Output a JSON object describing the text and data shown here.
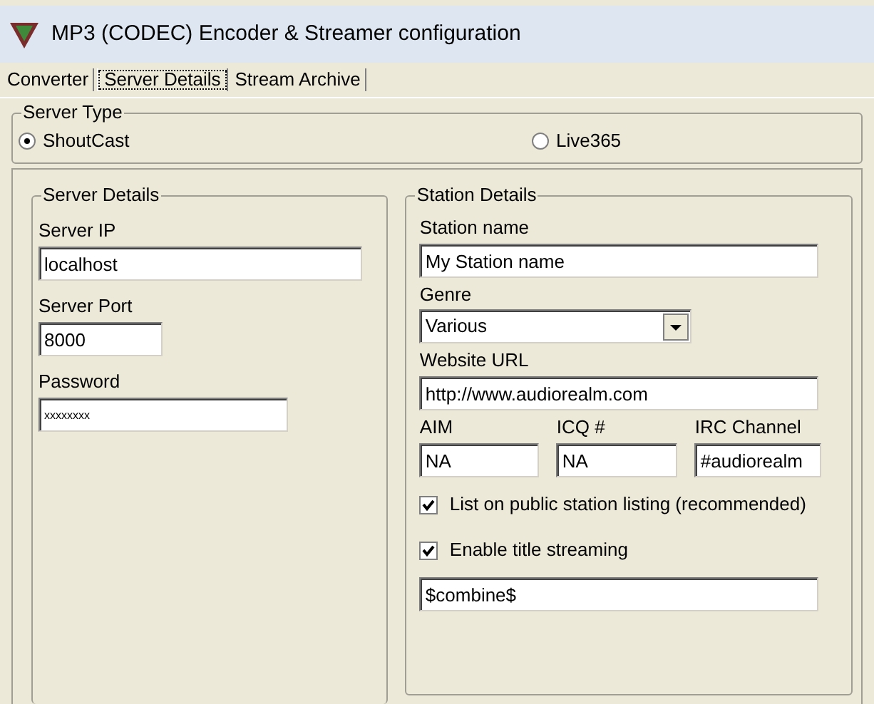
{
  "window": {
    "title": "MP3 (CODEC) Encoder & Streamer configuration"
  },
  "tabs": [
    {
      "label": "Converter",
      "selected": false
    },
    {
      "label": "Server Details",
      "selected": true
    },
    {
      "label": "Stream Archive",
      "selected": false
    }
  ],
  "server_type": {
    "label": "Server Type",
    "options": [
      {
        "label": "ShoutCast",
        "selected": true
      },
      {
        "label": "Live365",
        "selected": false
      }
    ]
  },
  "server_details": {
    "label": "Server Details",
    "server_ip": {
      "label": "Server IP",
      "value": "localhost"
    },
    "server_port": {
      "label": "Server Port",
      "value": "8000"
    },
    "password": {
      "label": "Password",
      "value": "xxxxxxxx"
    }
  },
  "station_details": {
    "label": "Station Details",
    "station_name": {
      "label": "Station name",
      "value": "My Station name"
    },
    "genre": {
      "label": "Genre",
      "value": "Various"
    },
    "website_url": {
      "label": "Website URL",
      "value": "http://www.audiorealm.com"
    },
    "contacts": [
      {
        "label": "AIM",
        "value": "NA"
      },
      {
        "label": "ICQ #",
        "value": "NA"
      },
      {
        "label": "IRC Channel",
        "value": "#audiorealm"
      }
    ],
    "checkboxes": [
      {
        "label": "List on public station listing (recommended)",
        "checked": true
      },
      {
        "label": "Enable title streaming",
        "checked": true
      }
    ],
    "title_format": {
      "value": "$combine$"
    }
  }
}
